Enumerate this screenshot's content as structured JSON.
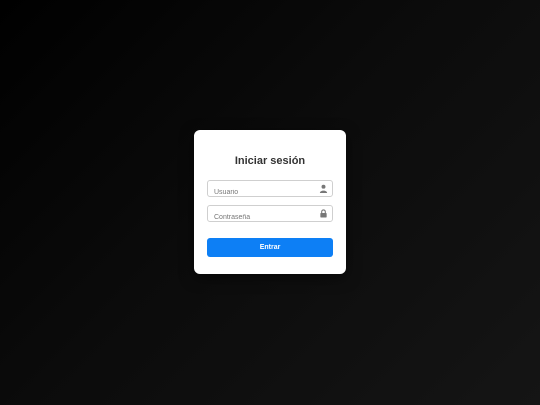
{
  "login": {
    "title": "Iniciar sesión",
    "username": {
      "placeholder": "Usuario",
      "value": "",
      "icon": "user-icon"
    },
    "password": {
      "placeholder": "Contraseña",
      "value": "",
      "icon": "lock-icon"
    },
    "submit_label": "Entrar"
  },
  "colors": {
    "accent": "#0d7ff5",
    "card_background": "#ffffff",
    "page_background": "#000000"
  }
}
